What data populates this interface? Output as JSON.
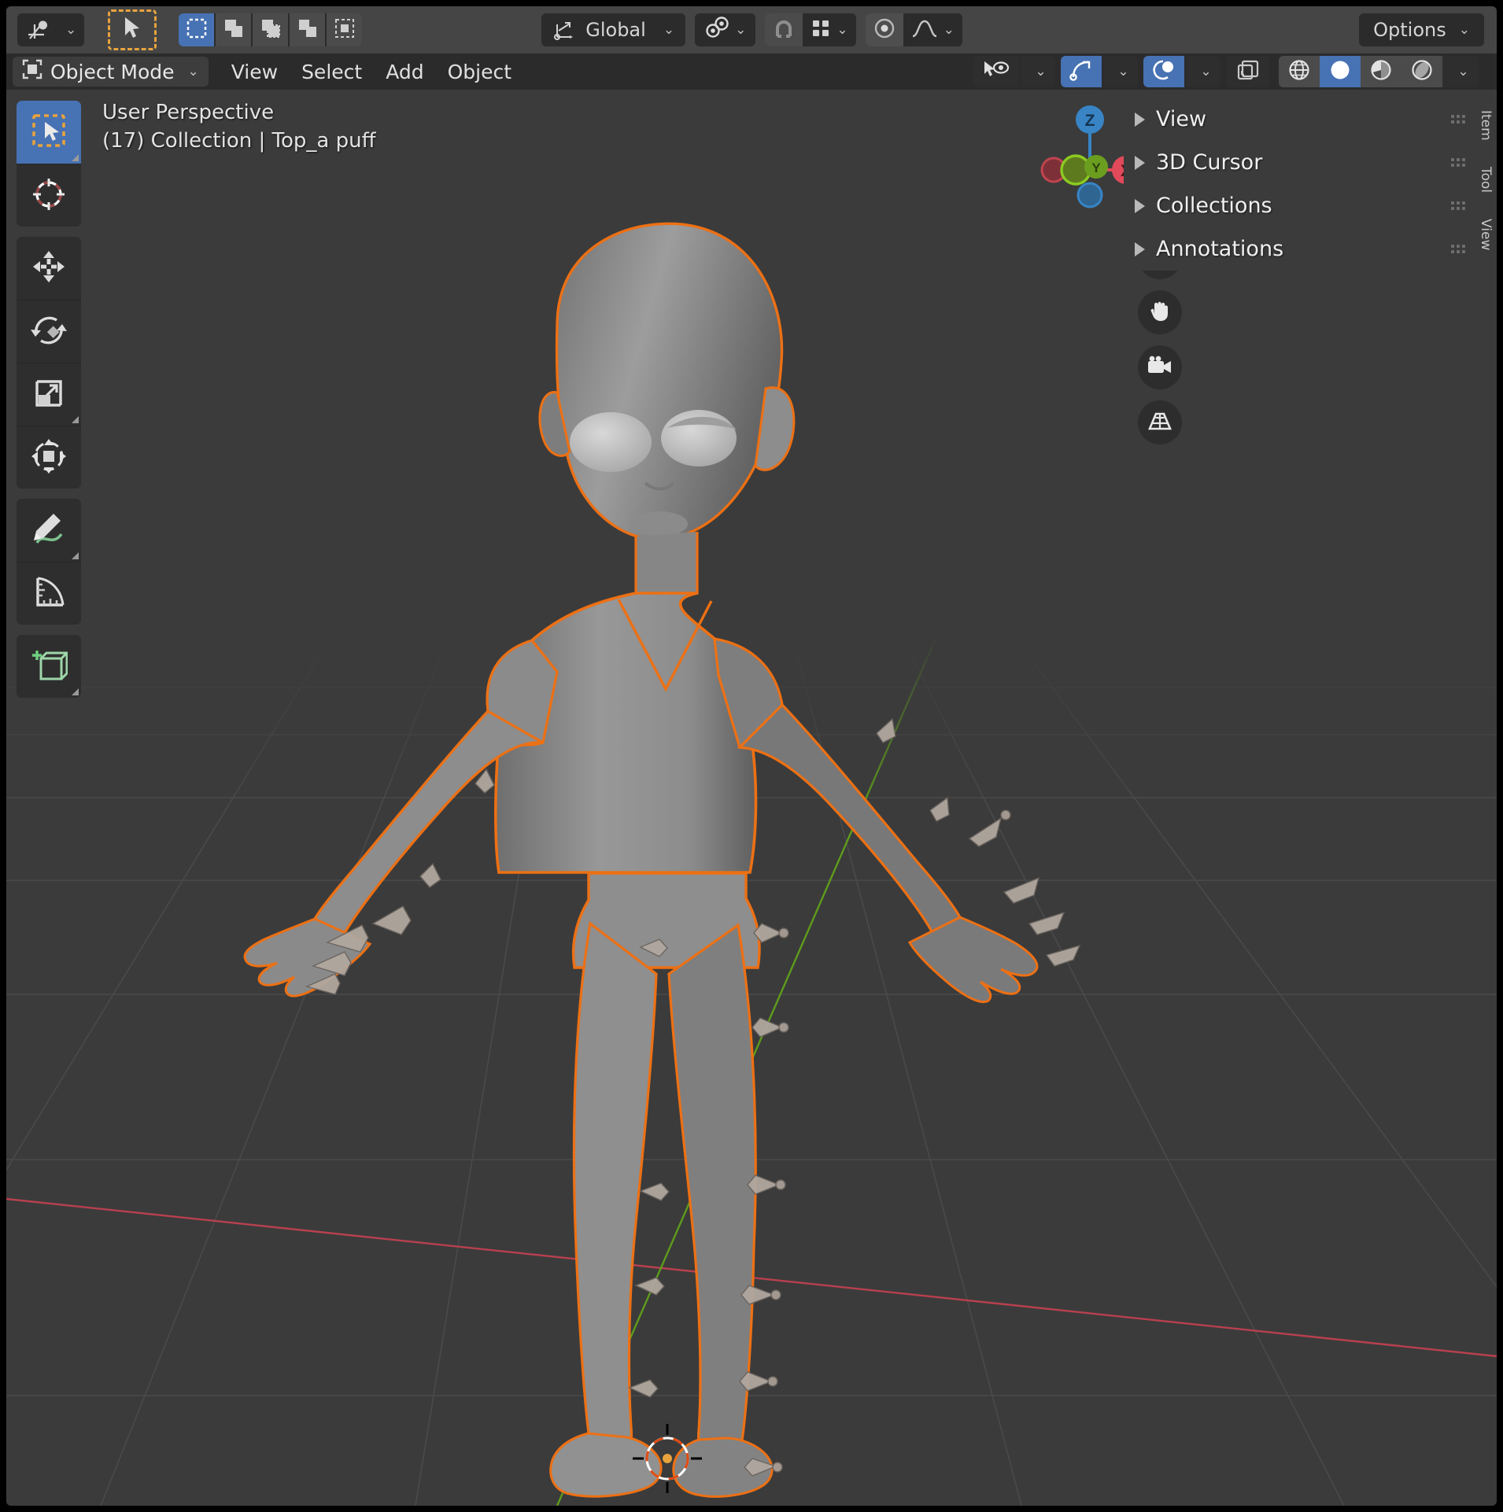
{
  "app": {
    "name": "Blender",
    "editor": "3D Viewport"
  },
  "tool_header": {
    "editor_type_icon": "editor-type-icon",
    "active_tool_icon": "tweak-select-tool-icon",
    "select_modes": [
      {
        "name": "set-select-mode",
        "icon": "select-set-icon",
        "active": true
      },
      {
        "name": "extend-select-mode",
        "icon": "select-extend-icon",
        "active": false
      },
      {
        "name": "subtract-select-mode",
        "icon": "select-subtract-icon",
        "active": false
      },
      {
        "name": "invert-select-mode",
        "icon": "select-invert-icon",
        "active": false
      },
      {
        "name": "intersect-select-mode",
        "icon": "select-intersect-icon",
        "active": false
      }
    ],
    "transform_orientation": {
      "label": "Global",
      "icon": "orientation-icon"
    },
    "transform_pivot": {
      "icon": "pivot-point-icon"
    },
    "snap_magnet": {
      "icon": "magnet-icon",
      "enabled": false
    },
    "snap_to": {
      "icon": "snap-grid-icon"
    },
    "proportional_editing": {
      "icon": "proportional-edit-icon",
      "enabled": true
    },
    "falloff": {
      "icon": "falloff-smooth-icon"
    },
    "options": {
      "label": "Options"
    }
  },
  "view_header": {
    "mode": {
      "label": "Object Mode",
      "icon": "object-mode-icon"
    },
    "menus": [
      {
        "label": "View"
      },
      {
        "label": "Select"
      },
      {
        "label": "Add"
      },
      {
        "label": "Object"
      }
    ],
    "right_icons": [
      {
        "name": "visibility-icon",
        "icon": "eye-cursor-icon",
        "active": false,
        "has_dropdown": true
      },
      {
        "name": "gizmos-icon",
        "icon": "gizmo-icon",
        "active": true,
        "has_dropdown": true
      },
      {
        "name": "overlays-icon",
        "icon": "overlay-icon",
        "active": true,
        "has_dropdown": true
      },
      {
        "name": "xray-icon",
        "icon": "xray-toggle-icon",
        "active": false,
        "has_dropdown": false
      }
    ],
    "shading_modes": [
      {
        "name": "wireframe-shading",
        "icon": "wireframe-icon",
        "active": false
      },
      {
        "name": "solid-shading",
        "icon": "solid-sphere-icon",
        "active": true
      },
      {
        "name": "material-preview-shading",
        "icon": "material-preview-icon",
        "active": false
      },
      {
        "name": "rendered-shading",
        "icon": "rendered-icon",
        "active": false
      }
    ]
  },
  "viewport": {
    "perspective_label": "User Perspective",
    "scene_info": "(17) Collection | Top_a puff",
    "grid_color": "#4a4a4a",
    "x_axis_color": "#b74e5a",
    "y_axis_color": "#68a81e",
    "background_color": "#3b3b3b",
    "selection_outline_color": "#ed7014",
    "mesh_color": "#8a8a8a"
  },
  "toolbar": {
    "groups": [
      [
        {
          "name": "tweak-tool",
          "icon": "tweak-select-box-icon",
          "active": true,
          "expandable": true
        },
        {
          "name": "cursor-tool",
          "icon": "3d-cursor-icon",
          "active": false,
          "expandable": false
        }
      ],
      [
        {
          "name": "move-tool",
          "icon": "move-arrows-icon",
          "active": false,
          "expandable": false
        },
        {
          "name": "rotate-tool",
          "icon": "rotate-icon",
          "active": false,
          "expandable": false
        },
        {
          "name": "scale-tool",
          "icon": "scale-icon",
          "active": false,
          "expandable": true
        },
        {
          "name": "transform-tool",
          "icon": "transform-icon",
          "active": false,
          "expandable": false
        }
      ],
      [
        {
          "name": "annotate-tool",
          "icon": "annotate-pencil-icon",
          "active": false,
          "expandable": true
        },
        {
          "name": "measure-tool",
          "icon": "measure-ruler-icon",
          "active": false,
          "expandable": false
        }
      ],
      [
        {
          "name": "add-cube-tool",
          "icon": "add-cube-icon",
          "active": false,
          "expandable": true
        }
      ]
    ]
  },
  "gizmo": {
    "axes": [
      {
        "label": "Z",
        "name": "axis-z-positive",
        "color": "#3884c5",
        "filled": true
      },
      {
        "label": "X",
        "name": "axis-x-positive",
        "color": "#e04a5a",
        "filled": true
      },
      {
        "label": "Y",
        "name": "axis-y-positive",
        "color": "#6b9e1f",
        "filled": true
      },
      {
        "label": "",
        "name": "axis-x-negative",
        "color": "#7e3038",
        "filled": false
      },
      {
        "label": "",
        "name": "axis-y-negative",
        "color": "#7fb224",
        "filled": false
      },
      {
        "label": "",
        "name": "axis-z-negative",
        "color": "#2f6591",
        "filled": false
      }
    ]
  },
  "nav_buttons": [
    {
      "name": "zoom-button",
      "icon": "magnifier-plus-icon"
    },
    {
      "name": "pan-button",
      "icon": "hand-icon"
    },
    {
      "name": "camera-view-button",
      "icon": "camera-icon"
    },
    {
      "name": "toggle-ortho-button",
      "icon": "perspective-grid-icon"
    }
  ],
  "sidebar": {
    "panels": [
      {
        "label": "View",
        "name": "sidebar-panel-view",
        "expanded": false
      },
      {
        "label": "3D Cursor",
        "name": "sidebar-panel-3d-cursor",
        "expanded": false
      },
      {
        "label": "Collections",
        "name": "sidebar-panel-collections",
        "expanded": false
      },
      {
        "label": "Annotations",
        "name": "sidebar-panel-annotations",
        "expanded": false
      }
    ],
    "tabs": [
      {
        "label": "Item",
        "name": "sidebar-tab-item",
        "active": false
      },
      {
        "label": "Tool",
        "name": "sidebar-tab-tool",
        "active": false
      },
      {
        "label": "View",
        "name": "sidebar-tab-view",
        "active": true
      }
    ]
  }
}
